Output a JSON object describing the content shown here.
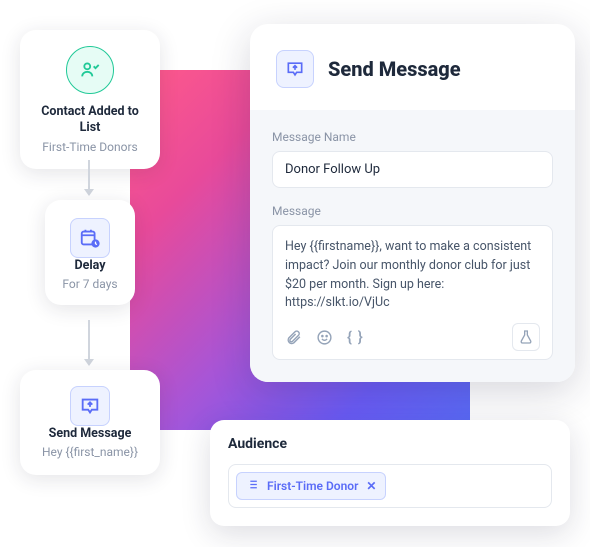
{
  "workflow": {
    "nodes": [
      {
        "title": "Contact Added to List",
        "subtitle": "First-Time Donors"
      },
      {
        "title": "Delay",
        "subtitle": "For 7 days"
      },
      {
        "title": "Send Message",
        "subtitle": "Hey {{first_name}}"
      }
    ]
  },
  "panel": {
    "title": "Send Message",
    "message_name_label": "Message Name",
    "message_name_value": "Donor Follow Up",
    "message_label": "Message",
    "message_value": "Hey {{firstname}}, want to make a consistent impact? Join our monthly donor club for just $20 per month. Sign up here: https://slkt.io/VjUc",
    "toolbar": {
      "braces": "{ }"
    }
  },
  "audience": {
    "title": "Audience",
    "chip_text": "First-Time Donor",
    "chip_close": "✕"
  }
}
